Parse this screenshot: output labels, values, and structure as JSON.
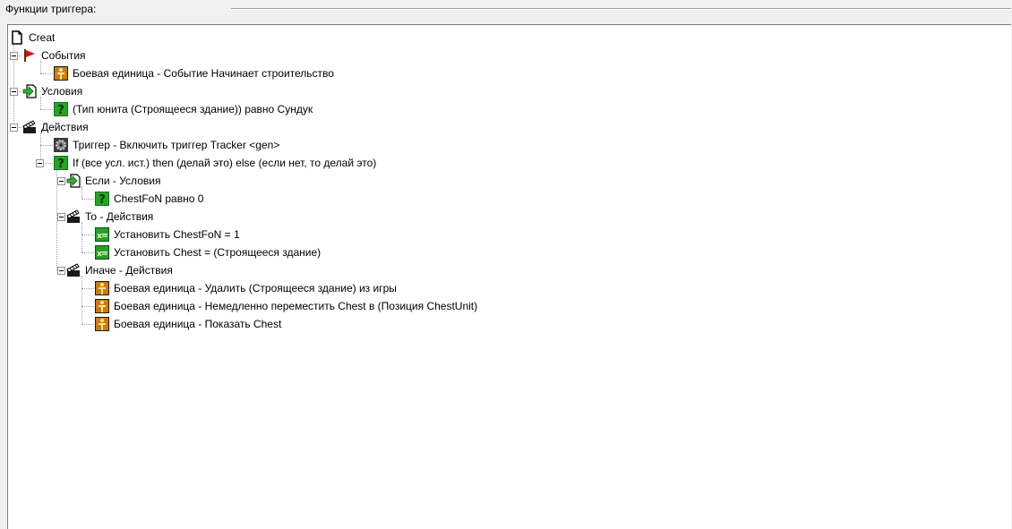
{
  "group_title": "Функции триггера:",
  "tree": {
    "root": {
      "label": "Creat",
      "icon": "document-icon"
    },
    "events": {
      "label": "События",
      "icon": "red-flag-icon"
    },
    "events_item": {
      "label": "Боевая единица - Событие Начинает строительство",
      "icon": "unit-icon"
    },
    "conditions": {
      "label": "Условия",
      "icon": "green-arrow-doc-icon"
    },
    "conditions_item": {
      "label": "(Тип юнита (Строящееся здание)) равно Сундук",
      "icon": "question-icon"
    },
    "actions": {
      "label": "Действия",
      "icon": "clapper-icon"
    },
    "action_trigger": {
      "label": "Триггер - Включить триггер Tracker <gen>",
      "icon": "gear-icon"
    },
    "action_if": {
      "label": "If (все усл. ист.) then (делай это) else (если нет, то делай это)",
      "icon": "question-icon"
    },
    "if_conditions": {
      "label": "Если - Условия",
      "icon": "green-arrow-doc-icon"
    },
    "if_conditions_item": {
      "label": "ChestFoN равно 0",
      "icon": "question-icon"
    },
    "then_actions": {
      "label": "То - Действия",
      "icon": "clapper-icon"
    },
    "then_item_1": {
      "label": "Установить ChestFoN = 1",
      "icon": "set-variable-icon"
    },
    "then_item_2": {
      "label": "Установить Chest = (Строящееся здание)",
      "icon": "set-variable-icon"
    },
    "else_actions": {
      "label": "Иначе - Действия",
      "icon": "clapper-icon"
    },
    "else_item_1": {
      "label": "Боевая единица - Удалить (Строящееся здание) из игры",
      "icon": "unit-icon"
    },
    "else_item_2": {
      "label": "Боевая единица - Немедленно переместить Chest в (Позиция ChestUnit)",
      "icon": "unit-icon"
    },
    "else_item_3": {
      "label": "Боевая единица - Показать Chest",
      "icon": "unit-icon"
    }
  }
}
